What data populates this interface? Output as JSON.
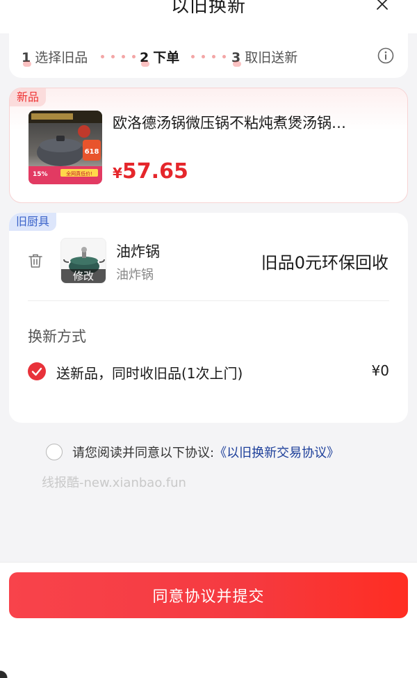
{
  "header": {
    "title": "以旧换新"
  },
  "steps": [
    {
      "num": "1",
      "label": "选择旧品"
    },
    {
      "num": "2",
      "label": "下单"
    },
    {
      "num": "3",
      "label": "取旧送新"
    }
  ],
  "new_product": {
    "tag": "新品",
    "title": "欧洛德汤锅微压锅不粘炖煮煲汤锅…",
    "price_symbol": "¥",
    "price": "57.65",
    "image_texts": {
      "sale_618": "618",
      "discount": "15%",
      "promo": "全网真低价!"
    }
  },
  "old_item": {
    "tag": "旧厨具",
    "name": "油炸锅",
    "subtitle": "油炸锅",
    "edit_label": "修改",
    "value_label": "旧品0元环保回收"
  },
  "method": {
    "title": "换新方式",
    "option": "送新品，同时收旧品(1次上门)",
    "price": "¥0"
  },
  "agreement": {
    "text": "请您阅读并同意以下协议:",
    "link": "《以旧换新交易协议》"
  },
  "watermark": "线报酷-new.xianbao.fun",
  "submit": {
    "label": "同意协议并提交"
  },
  "colors": {
    "accent": "#e5262b",
    "link": "#1d3f9a",
    "old_tag": "#3a62c9"
  }
}
